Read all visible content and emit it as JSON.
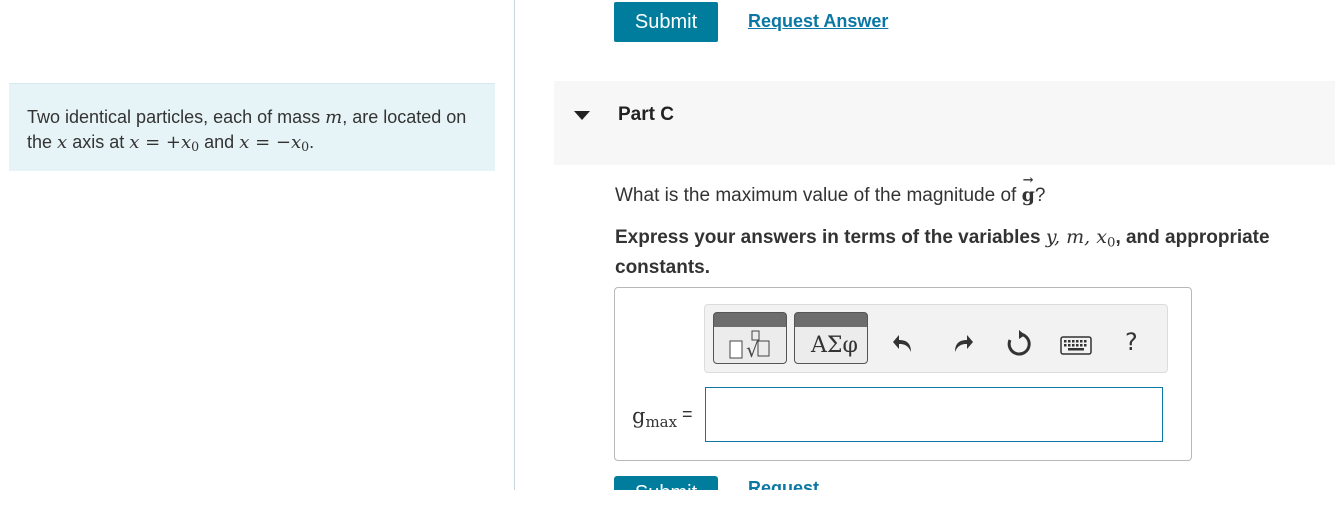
{
  "top_actions": {
    "submit_label": "Submit",
    "request_answer_label": "Request Answer"
  },
  "problem": {
    "text_1": "Two identical particles, each of mass ",
    "var_m": "m",
    "text_2": ", are located on the ",
    "var_x": "x",
    "text_3": " axis at ",
    "eq_1": "x = +x",
    "zero": "0",
    "text_4": " and ",
    "eq_2": "x = −x",
    "zero_2": "0",
    "text_5": "."
  },
  "part": {
    "label": "Part C",
    "expanded": true
  },
  "question": {
    "text": "What is the maximum value of the magnitude of ",
    "vector": "g",
    "end": "?"
  },
  "instruction": {
    "text_1": "Express your answers in terms of the variables ",
    "vars": "y, m, x",
    "zero": "0",
    "text_2": ", and appropriate constants."
  },
  "toolbar": {
    "templates_icon": "templates-icon",
    "greek_label": "ΑΣφ",
    "undo_icon": "undo-icon",
    "redo_icon": "redo-icon",
    "reset_icon": "reset-icon",
    "keyboard_icon": "keyboard-icon",
    "help_label": "?"
  },
  "answer": {
    "var": "g",
    "subscript": "max",
    "equals": "=",
    "value": ""
  },
  "bottom_actions": {
    "submit_label": "Submit",
    "request_answer_label": "Request Answer"
  },
  "colors": {
    "accent": "#007c9d",
    "link": "#0a77a4",
    "problem_bg": "#e7f4f7"
  }
}
